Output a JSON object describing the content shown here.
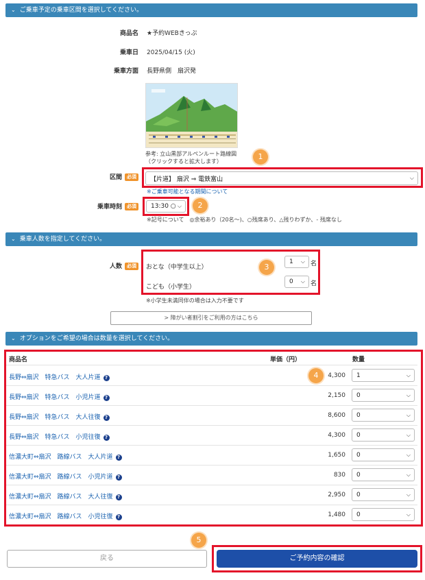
{
  "section1": {
    "header": "ご乗車予定の乗車区間を選択してください。",
    "product_label": "商品名",
    "product_value": "★予約WEBきっぷ",
    "date_label": "乗車日",
    "date_value": "2025/04/15 (火)",
    "direction_label": "乗車方面",
    "direction_value": "長野県側　扇沢発",
    "map_caption_line1": "参考: 立山黒部アルペンルート路線図",
    "map_caption_line2": "（クリックすると拡大します）",
    "route_label": "区間",
    "required": "必須",
    "route_value": "【片道】 扇沢 ⇒ 電鉄富山",
    "route_note": "※ご乗車可能となる期間について",
    "time_label": "乗車時刻",
    "time_value": "13:30 ○",
    "time_note": "※記号について　◎余裕あり（20名～)、○残席あり、△残りわずか、- 残席なし"
  },
  "section2": {
    "header": "乗車人数を指定してください。",
    "people_label": "人数",
    "adult_label": "おとな（中学生以上）",
    "adult_value": "1",
    "child_label": "こども（小学生）",
    "child_value": "0",
    "unit": "名",
    "note": "※小学生未満同伴の場合は入力不要です",
    "discount_button": "> 障がい者割引をご利用の方はこちら"
  },
  "section3": {
    "header": "オプションをご希望の場合は数量を選択してください。",
    "col_product": "商品名",
    "col_price": "単価（円）",
    "col_qty": "数量",
    "help_icon": "?",
    "rows": [
      {
        "name": "長野⇔扇沢　特急バス　大人片道",
        "price": "4,300",
        "qty": "1"
      },
      {
        "name": "長野⇔扇沢　特急バス　小児片道",
        "price": "2,150",
        "qty": "0"
      },
      {
        "name": "長野⇔扇沢　特急バス　大人往復",
        "price": "8,600",
        "qty": "0"
      },
      {
        "name": "長野⇔扇沢　特急バス　小児往復",
        "price": "4,300",
        "qty": "0"
      },
      {
        "name": "信濃大町⇔扇沢　路線バス　大人片道",
        "price": "1,650",
        "qty": "0"
      },
      {
        "name": "信濃大町⇔扇沢　路線バス　小児片道",
        "price": "830",
        "qty": "0"
      },
      {
        "name": "信濃大町⇔扇沢　路線バス　大人往復",
        "price": "2,950",
        "qty": "0"
      },
      {
        "name": "信濃大町⇔扇沢　路線バス　小児往復",
        "price": "1,480",
        "qty": "0"
      }
    ]
  },
  "buttons": {
    "back": "戻る",
    "confirm": "ご予約内容の確認"
  },
  "badges": [
    "1",
    "2",
    "3",
    "4",
    "5"
  ],
  "colors": {
    "header_bg": "#3a87b8",
    "required_bg": "#f0932b",
    "highlight": "#e3132a",
    "badge": "#f5a54a",
    "link": "#1a62b0",
    "confirm_bg": "#1d4fa8"
  }
}
